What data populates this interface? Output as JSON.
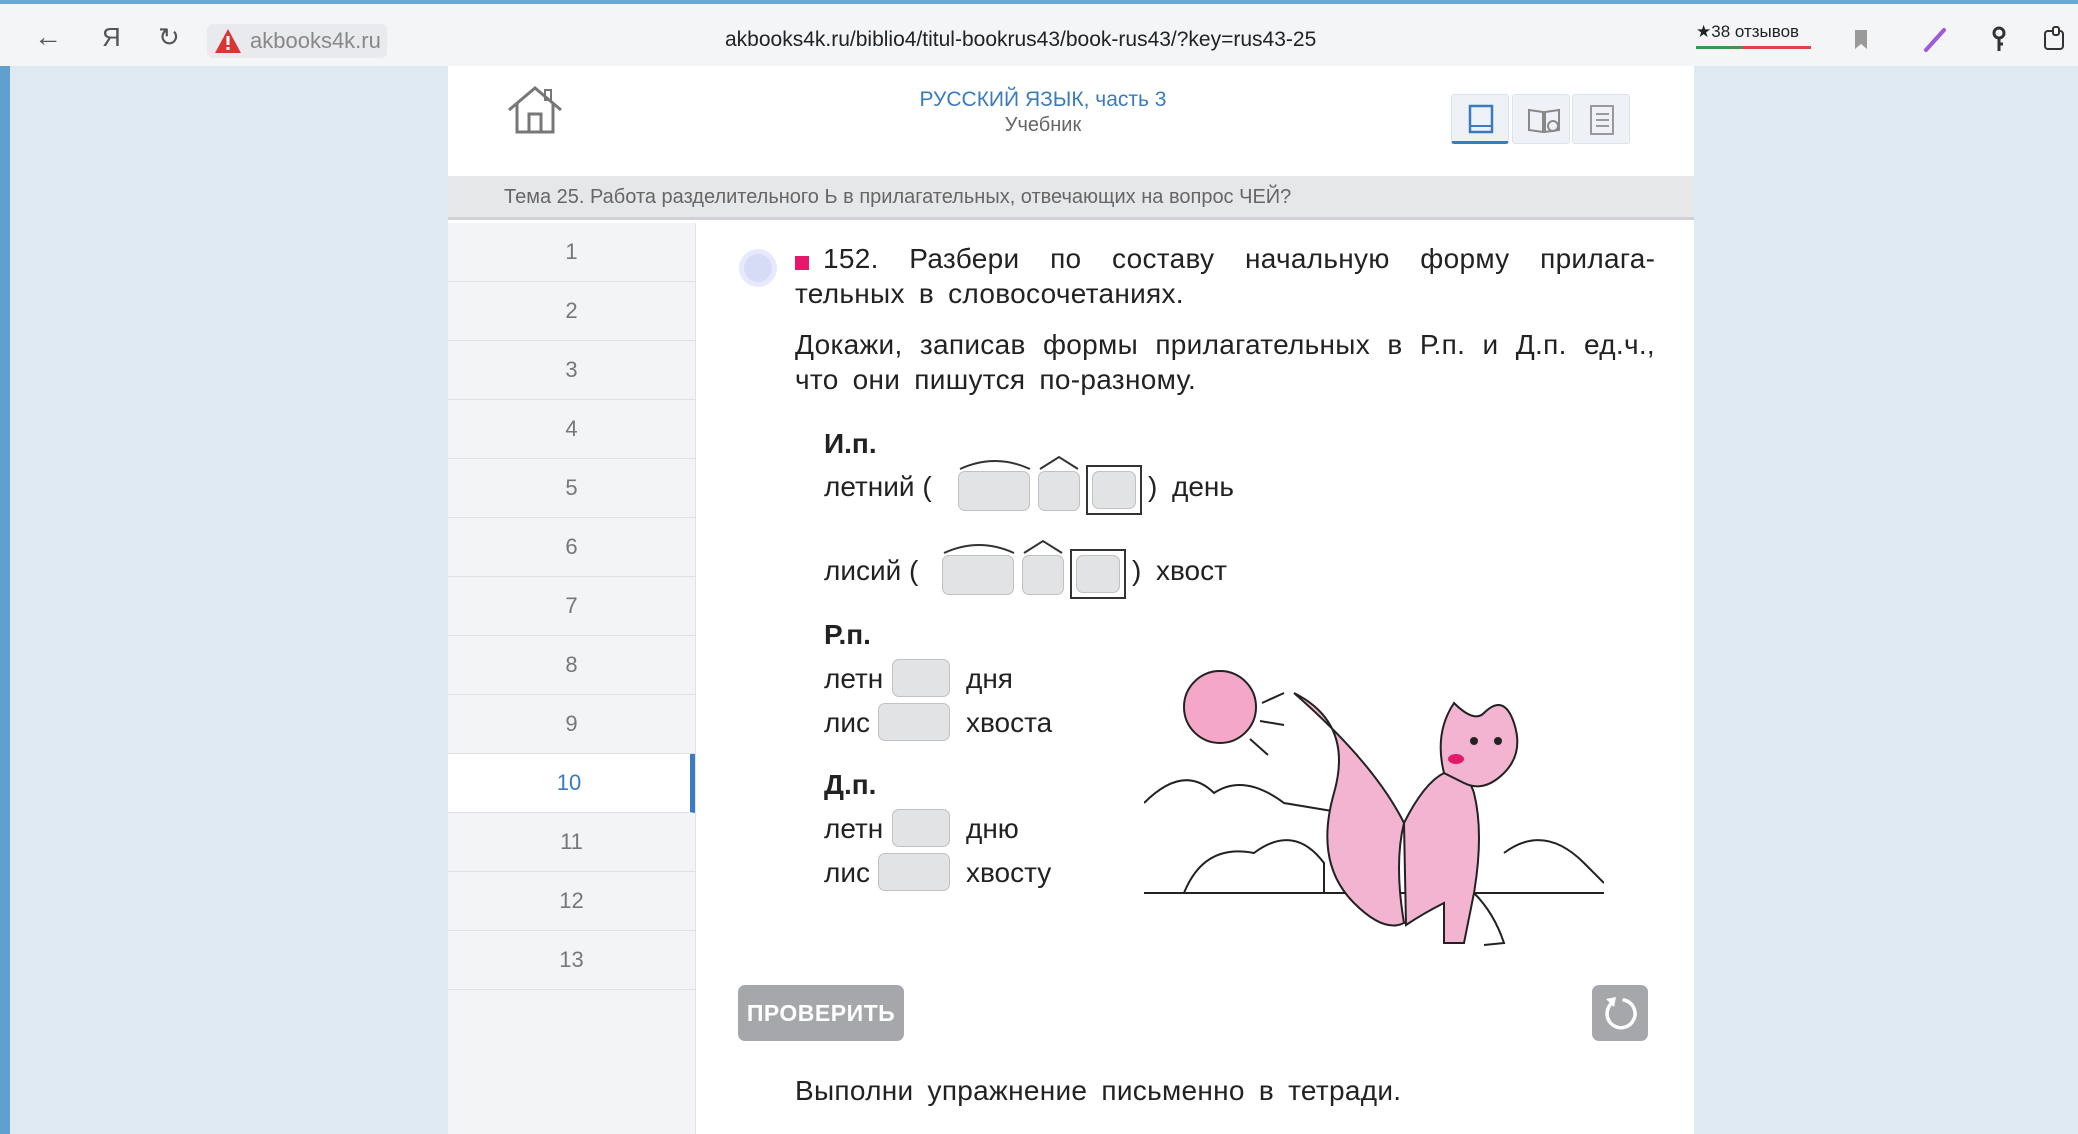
{
  "browser": {
    "site_name": "akbooks4k.ru",
    "url": "akbooks4k.ru/biblio4/titul-bookrus43/book-rus43/?key=rus43-25",
    "reviews": "★38 отзывов",
    "icons": [
      "back-icon",
      "yandex-icon",
      "reload-icon",
      "warning-icon",
      "bookmark-icon",
      "pen-icon",
      "key-icon",
      "extension-icon"
    ]
  },
  "book": {
    "title": "РУССКИЙ ЯЗЫК, часть 3",
    "subtitle": "Учебник",
    "view_icons": [
      "page-view-icon",
      "book-view-icon",
      "contents-view-icon"
    ]
  },
  "topic": "Тема 25. Работа разделительного Ь в прилагательных, отвечающих на вопрос ЧЕЙ?",
  "sidebar": {
    "items": [
      "1",
      "2",
      "3",
      "4",
      "5",
      "6",
      "7",
      "8",
      "9",
      "10",
      "11",
      "12",
      "13"
    ],
    "active": "10"
  },
  "exercise": {
    "task1": "152. Разбери по составу начальную форму прилага­тельных в словосочетаниях.",
    "task2": "Докажи, записав формы прилагательных в Р.п. и Д.п. ед.ч., что они пишутся по-разному.",
    "nom": {
      "label": "И.п.",
      "row1_word": "летний (",
      "row1_close": ")",
      "row1_noun": "день",
      "row2_word": "лисий (",
      "row2_close": ")",
      "row2_noun": "хвост"
    },
    "gen": {
      "label": "Р.п.",
      "row1_stem": "летн",
      "row1_noun": "дня",
      "row2_stem": "лис",
      "row2_noun": "хвоста"
    },
    "dat": {
      "label": "Д.п.",
      "row1_stem": "летн",
      "row1_noun": "дню",
      "row2_stem": "лис",
      "row2_noun": "хвосту"
    },
    "check_button": "ПРОВЕРИТЬ",
    "footer": "Выполни упражнение письменно в тетради."
  },
  "colors": {
    "accent": "#3a7bbf",
    "pink_marker": "#e5196b",
    "button": "#a5a7aa"
  }
}
